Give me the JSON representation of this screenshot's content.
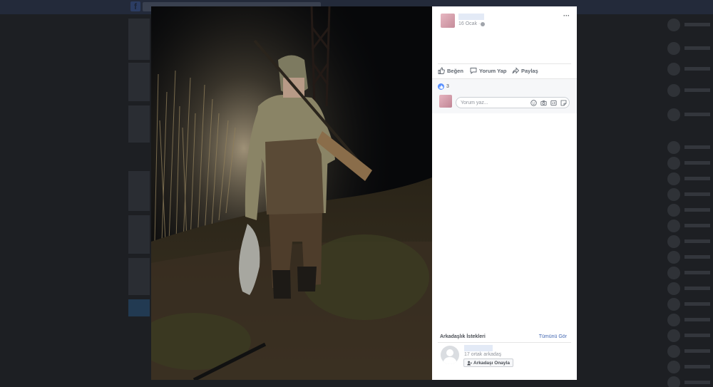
{
  "post": {
    "date": "16 Ocak ·",
    "more_icon": "···"
  },
  "actions": {
    "like": "Beğen",
    "comment": "Yorum Yap",
    "share": "Paylaş"
  },
  "reactions": {
    "count": "3"
  },
  "comment_input": {
    "placeholder": "Yorum yaz..."
  },
  "friend_requests": {
    "title": "Arkadaşlık İstekleri",
    "see_all": "Tümünü Gör",
    "request": {
      "mutual": "17 ortak arkadaş",
      "confirm": "Arkadaşı Onayla"
    }
  },
  "icons": {
    "like": "thumbs-up-icon",
    "comment": "speech-bubble-icon",
    "share": "share-arrow-icon",
    "emoji": "smiley-icon",
    "camera": "camera-icon",
    "gif": "gif-icon",
    "sticker": "sticker-icon"
  },
  "colors": {
    "brand": "#4267b2",
    "like_blue": "#5890ff",
    "overlay": "#1d1f23"
  }
}
